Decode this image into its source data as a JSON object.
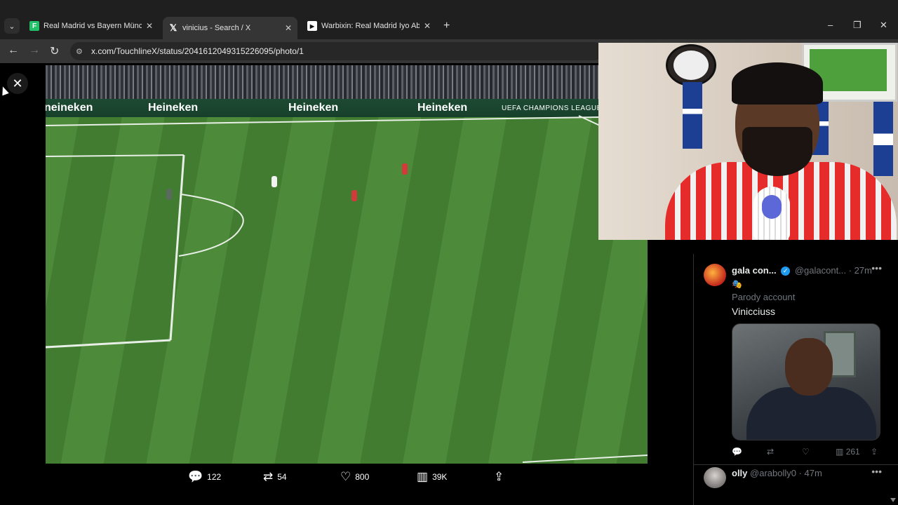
{
  "browser": {
    "tabs": [
      {
        "title": "Real Madrid vs Bayern München",
        "favicon": "flashscore-icon",
        "active": false
      },
      {
        "title": "vinicius - Search / X",
        "favicon": "x-logo-icon",
        "active": true
      },
      {
        "title": "Warbixin: Real Madrid Iyo Abbo",
        "favicon": "play-icon",
        "active": false
      }
    ],
    "new_tab_symbol": "+",
    "url": "x.com/TouchlineX/status/2041612049315226095/photo/1",
    "window_controls": {
      "minimize": "–",
      "restore": "❐",
      "close": "✕"
    }
  },
  "photo": {
    "boards": [
      "neineken",
      "Heineken",
      "Heineken",
      "Heineken",
      "UEFA CHAMPIONS LEAGUE"
    ]
  },
  "photo_actions": {
    "replies": "122",
    "reposts": "54",
    "likes": "800",
    "views": "39K"
  },
  "timeline": {
    "tweets": [
      {
        "name": "gala con...",
        "verified": true,
        "handle": "@galacont...",
        "time": "· 27m",
        "emoji": "🎭",
        "label": "Parody account",
        "text": "Vinicciuss",
        "views": "261"
      },
      {
        "name": "olly",
        "handle": "@arabolly0",
        "time": "· 47m"
      }
    ]
  },
  "colors": {
    "accent": "#1d9bf0",
    "chrome": "#353535",
    "pitch": "#4d8a3a"
  }
}
